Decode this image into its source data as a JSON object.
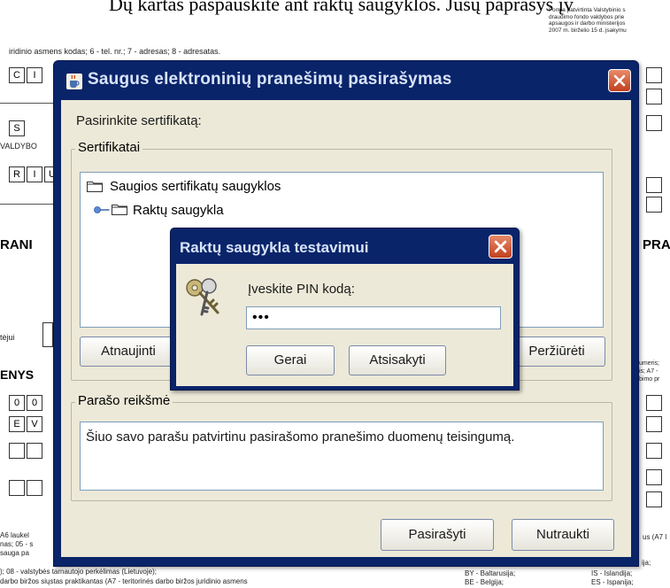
{
  "background_document": {
    "heading": "Dų kartas paspauskite ant raktų saugyklos. Jūsų paprašys įv",
    "form_note": "Forma patvirtinta Valstybinio s\ndraudimo fondo valdybos prie\napsaugos ir darbo ministerijos\n2007 m. birželio 15 d. įsakymu",
    "field_caption": "iridinio asmens kodas; 6 - tel. nr.; 7 - adresas; 8 - adresatas.",
    "cells_row1": [
      "C",
      "I"
    ],
    "cells_row2": [
      "S"
    ],
    "label_valdybo": "VALDYBO",
    "cells_row3": [
      "R",
      "I",
      "U"
    ],
    "label_rani": "RANI",
    "label_pra": "PRA",
    "label_tejui": "tėjui",
    "label_enys": "ENYS",
    "cells_row4": [
      "0",
      "0"
    ],
    "cells_row5": [
      "E",
      "V"
    ],
    "right_note_1": "umeris;\nis; A7 -\nbimo pr",
    "right_note_2": "us (A7 l",
    "footer_left_1": "A6 laukel",
    "footer_left_2": "nas; 05 - s",
    "footer_left_3": "sauga pa",
    "footer_left_4": "); 08 - valstybės tarnautojo perkėlimas (Lietuvoje);",
    "footer_left_5": "darbo biržos siųstas praktikantas (A7 - teritorinės darbo biržos juridinio asmens",
    "footer_mid_1": "BY - Baltarusija;",
    "footer_mid_2": "BE - Belgija;",
    "footer_right_1": "ija;",
    "footer_right_2": "IS - Islandija;",
    "footer_right_3": "ES - Ispanija;"
  },
  "main_window": {
    "title": "Saugus elektroninių pranešimų pasirašymas",
    "choose_label": "Pasirinkite sertifikatą:",
    "certificates_group": "Sertifikatai",
    "tree_root": "Saugios sertifikatų saugyklos",
    "tree_child": "Raktų saugykla",
    "refresh_button": "Atnaujinti",
    "view_button": "Peržiūrėti",
    "signature_group": "Parašo reikšmė",
    "signature_text": "Šiuo savo parašu patvirtinu pasirašomo pranešimo duomenų teisingumą.",
    "sign_button": "Pasirašyti",
    "abort_button": "Nutraukti"
  },
  "pin_dialog": {
    "title": "Raktų saugykla testavimui",
    "prompt": "Įveskite PIN kodą:",
    "pin_value": "•••",
    "ok_button": "Gerai",
    "cancel_button": "Atsisakyti"
  },
  "colors": {
    "title_bar": "#0a246a",
    "window_body": "#ece9d8",
    "close_button": "#d9542e"
  },
  "icons": [
    "java-cup-icon",
    "close-icon",
    "folder-icon",
    "tree-connector-icon",
    "keys-icon"
  ]
}
